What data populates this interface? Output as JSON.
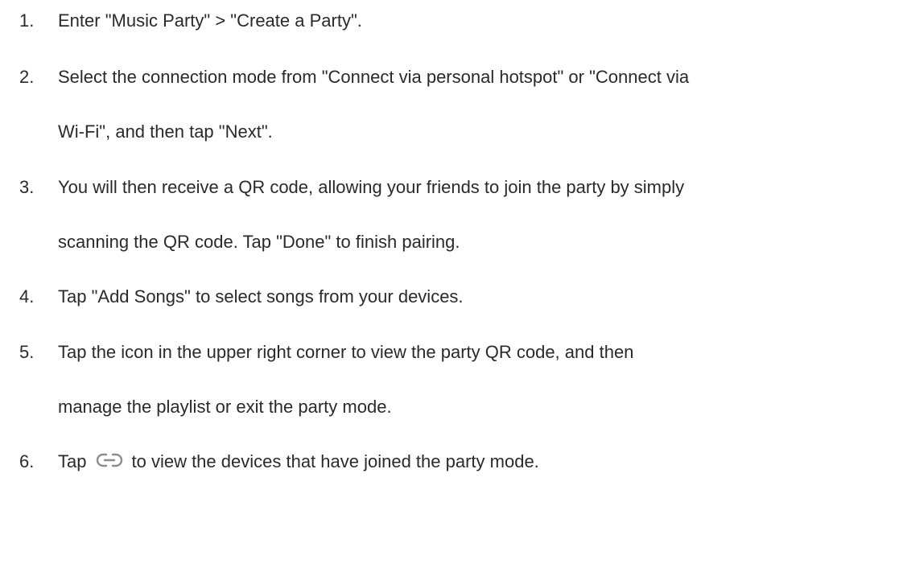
{
  "steps": [
    {
      "number": "1.",
      "lines": [
        "Enter \"Music Party\" > \"Create a Party\"."
      ]
    },
    {
      "number": "2.",
      "lines": [
        "Select the connection mode from \"Connect via personal hotspot\" or \"Connect via",
        "Wi-Fi\", and then tap \"Next\"."
      ]
    },
    {
      "number": "3.",
      "lines": [
        "You will then receive a QR code, allowing your friends to join the party by simply",
        "scanning the QR code. Tap \"Done\" to finish pairing."
      ]
    },
    {
      "number": "4.",
      "lines": [
        "Tap \"Add Songs\" to select songs from your devices."
      ]
    },
    {
      "number": "5.",
      "lines": [
        "Tap the icon in the upper right corner to view the party QR code, and then",
        "manage the playlist or exit the party mode."
      ]
    },
    {
      "number": "6.",
      "before_icon": "Tap",
      "icon": "link-icon",
      "after_icon": "to view the devices that have joined the party mode."
    }
  ]
}
